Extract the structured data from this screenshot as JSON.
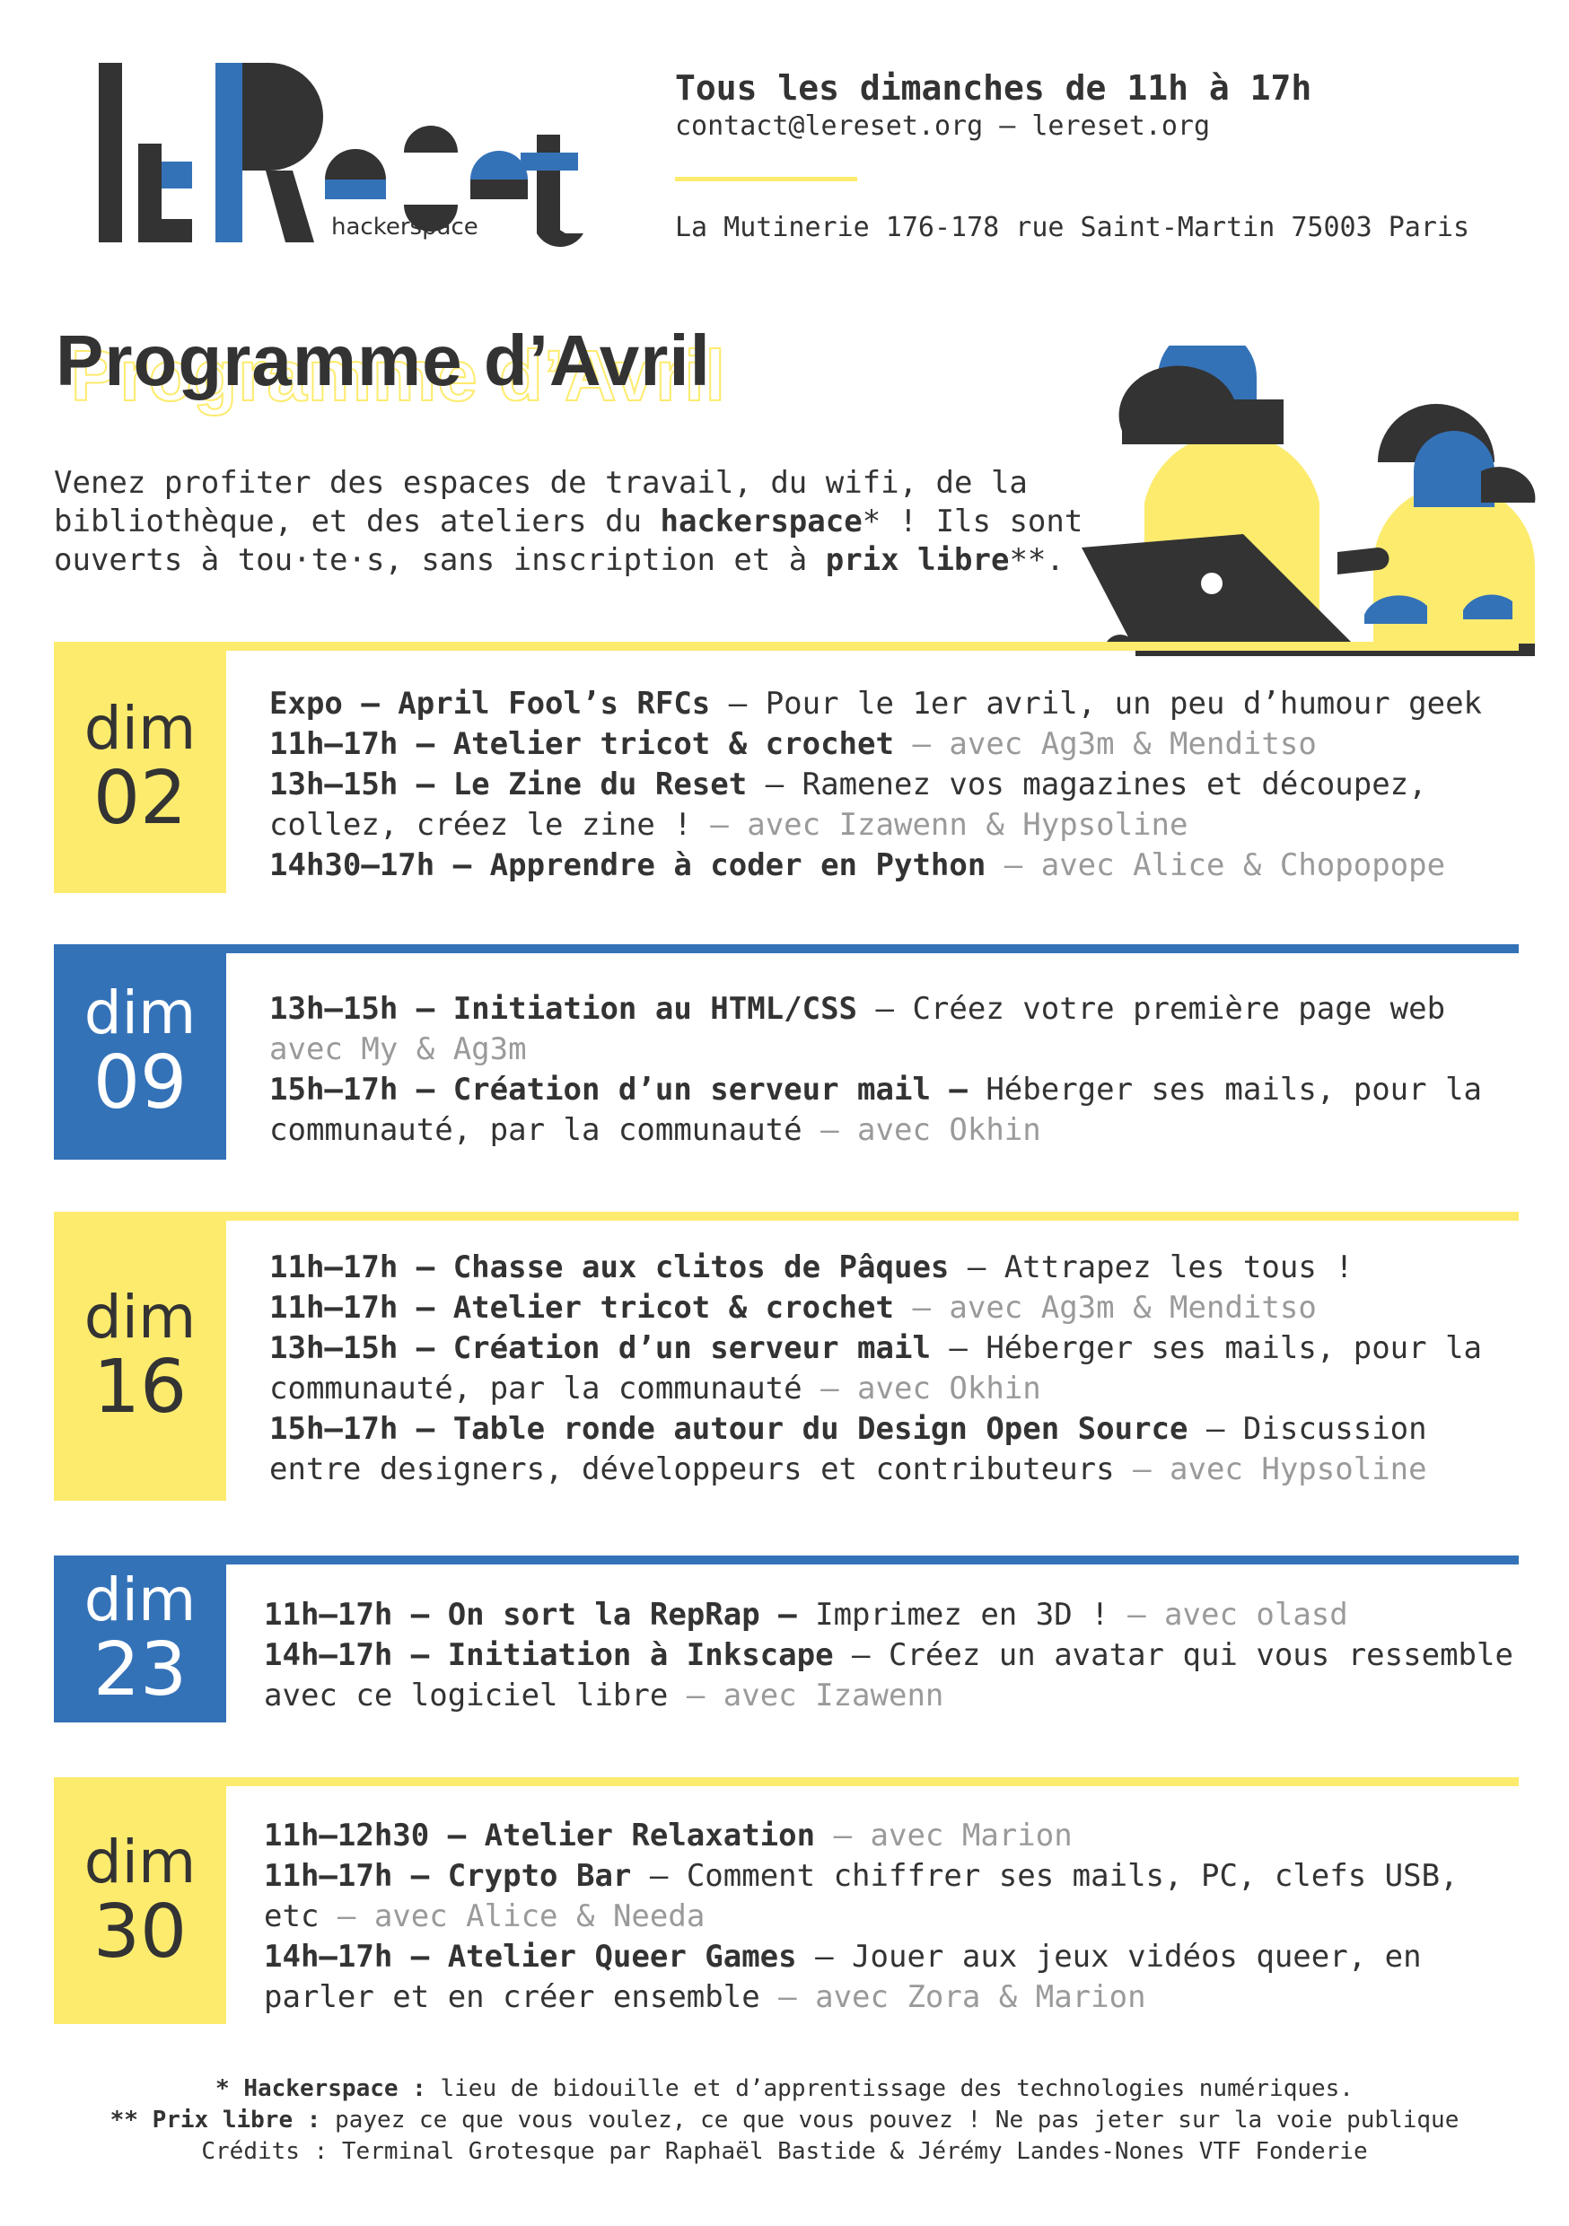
{
  "header": {
    "logo_text": "le Reset",
    "logo_caption": "hackerspace",
    "schedule": "Tous les dimanches de 11h à 17h",
    "contact": "contact@lereset.org – lereset.org",
    "address": "La Mutinerie 176-178 rue Saint-Martin 75003 Paris"
  },
  "title": "Programme d’Avril",
  "intro": {
    "part1": "Venez profiter des espaces de travail, du wifi, de la bibliothèque, et des ateliers du ",
    "hackerspace": "hackerspace",
    "part2": "* ! Ils sont ouverts à tou·te·s, sans inscription et à ",
    "prix_libre": "prix libre",
    "part3": "**."
  },
  "days": [
    {
      "name": "dim",
      "number": "02",
      "theme": "yellow",
      "events": [
        {
          "title": "Expo – April Fool’s RFCs",
          "desc": " – Pour le 1er avril, un peu d’humour geek",
          "host": ""
        },
        {
          "title": "11h–17h – Atelier tricot & crochet",
          "desc": "",
          "host": " – avec Ag3m & Menditso"
        },
        {
          "title": "13h–15h – Le Zine du Reset",
          "desc": " – Ramenez vos magazines et découpez, collez, créez le zine !",
          "host": " – avec Izawenn & Hypsoline"
        },
        {
          "title": "14h30–17h – Apprendre à coder en Python",
          "desc": "",
          "host": " – avec Alice & Chopopope"
        }
      ]
    },
    {
      "name": "dim",
      "number": "09",
      "theme": "blue",
      "events": [
        {
          "title": "13h–15h – Initiation au HTML/CSS",
          "desc": " – Créez votre première page web",
          "host": " avec My & Ag3m"
        },
        {
          "title": "15h–17h – Création d’un serveur mail –",
          "desc": " Héberger ses mails, pour la communauté, par la communauté",
          "host": " – avec Okhin"
        }
      ]
    },
    {
      "name": "dim",
      "number": "16",
      "theme": "yellow",
      "events": [
        {
          "title": "11h–17h – Chasse aux clitos de Pâques",
          "desc": " –  Attrapez les tous !",
          "host": ""
        },
        {
          "title": "11h–17h – Atelier tricot & crochet",
          "desc": "",
          "host": " – avec Ag3m & Menditso"
        },
        {
          "title": "13h–15h – Création d’un serveur mail",
          "desc": " – Héberger ses mails, pour la communauté, par la communauté",
          "host": " – avec Okhin"
        },
        {
          "title": "15h–17h – Table ronde autour du Design Open Source",
          "desc": " – Discussion entre designers, développeurs et contributeurs",
          "host": " – avec Hypsoline"
        }
      ]
    },
    {
      "name": "dim",
      "number": "23",
      "theme": "blue",
      "events": [
        {
          "title": "11h–17h – On sort la RepRap –",
          "desc": " Imprimez en 3D !",
          "host": " – avec olasd"
        },
        {
          "title": "14h–17h – Initiation à Inkscape",
          "desc": " – Créez un avatar qui vous ressemble avec ce logiciel libre",
          "host": " – avec Izawenn"
        }
      ]
    },
    {
      "name": "dim",
      "number": "30",
      "theme": "yellow",
      "events": [
        {
          "title": "11h–12h30 – Atelier Relaxation",
          "desc": "",
          "host": " – avec Marion"
        },
        {
          "title": "11h–17h – Crypto Bar",
          "desc": " – Comment chiffrer ses mails, PC, clefs USB, etc",
          "host": " – avec Alice & Needa"
        },
        {
          "title": "14h–17h – Atelier Queer Games",
          "desc": " – Jouer aux jeux vidéos queer, en parler et en créer ensemble",
          "host": " – avec Zora & Marion"
        }
      ]
    }
  ],
  "footer": {
    "note1_term": "* Hackerspace :",
    "note1_text": " lieu de bidouille et d’apprentissage des technologies numériques.",
    "note2_term": "** Prix libre :",
    "note2_text": " payez ce que vous voulez, ce que vous pouvez ! ",
    "note2_extra": "Ne pas jeter sur la voie publique",
    "credits": "Crédits : Terminal Grotesque par Raphaël Bastide & Jérémy Landes-Nones VTF Fonderie"
  },
  "colors": {
    "yellow": "#FDEB6E",
    "blue": "#3472B8",
    "dark": "#333333",
    "gray": "#9A9A9A"
  }
}
